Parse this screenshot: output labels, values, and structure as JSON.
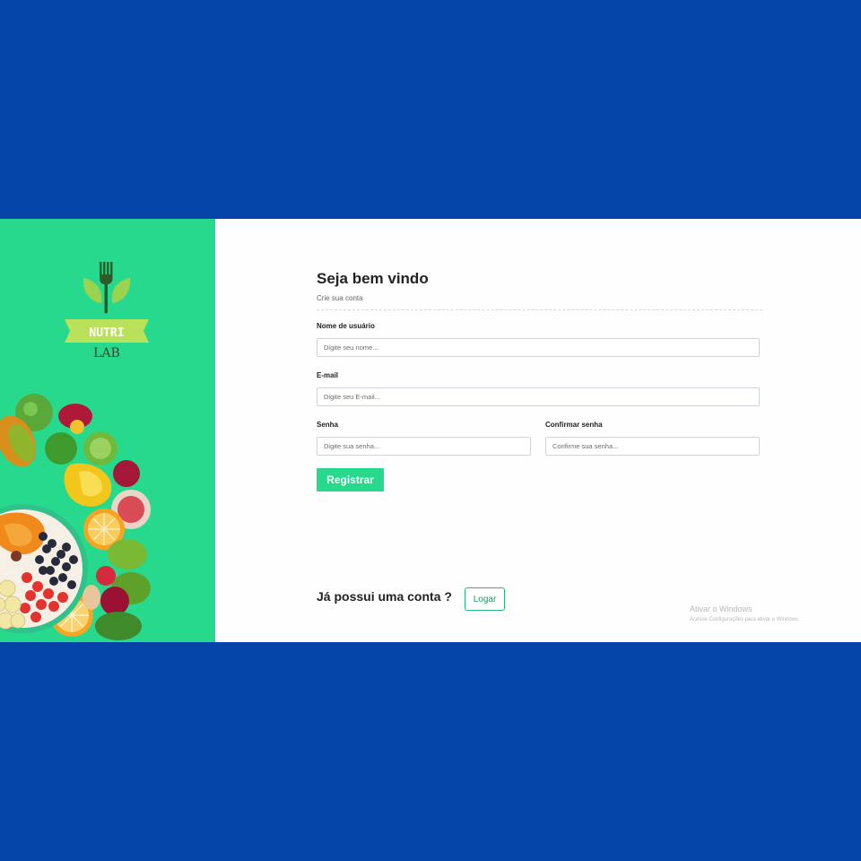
{
  "brand": {
    "name_line1": "NUTRI",
    "name_line2": "LAB"
  },
  "form": {
    "title": "Seja bem vindo",
    "subtitle": "Crie sua conta",
    "username": {
      "label": "Nome de usuário",
      "placeholder": "Digite seu nome...",
      "value": ""
    },
    "email": {
      "label": "E-mail",
      "placeholder": "Digite seu E-mail...",
      "value": ""
    },
    "password": {
      "label": "Senha",
      "placeholder": "Digite sua senha...",
      "value": ""
    },
    "confirm_password": {
      "label": "Confirmar senha",
      "placeholder": "Confirme sua senha...",
      "value": ""
    },
    "register_label": "Registrar"
  },
  "login": {
    "prompt": "Já possui uma conta ?",
    "button_label": "Logar"
  },
  "watermark": {
    "title": "Ativar o Windows",
    "subtitle": "Acesse Configurações para ativar o Windows."
  },
  "colors": {
    "accent": "#27d98c",
    "background": "#0444a8",
    "logo_ribbon": "#b9e15a"
  },
  "icons": {
    "logo": "fork-leaf-icon",
    "illustration": "fruit-bowl-image"
  }
}
